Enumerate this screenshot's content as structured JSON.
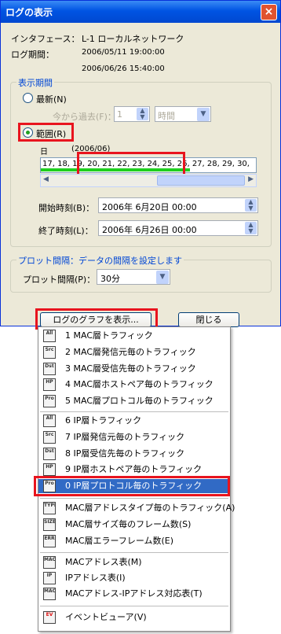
{
  "window": {
    "title": "ログの表示",
    "close": "×"
  },
  "info": {
    "interface_label": "インタフェース：",
    "interface_value": "L-1 ローカルネットワーク",
    "period_label": "ログ期間：",
    "period_start": "2006/05/11 19:00:00",
    "period_end": "2006/06/26 15:40:00"
  },
  "display_period": {
    "group_title": "表示期間",
    "latest_label": "最新(N)",
    "past_label": "今から過去(F)：",
    "past_value": "1",
    "past_unit": "時間",
    "range_label": "範囲(R)",
    "timeline_day_label": "日",
    "timeline_month": "(2006/06)",
    "timeline_days": "17, 18, 19, 20, 21, 22, 23, 24, 25, 26, 27, 28, 29, 30,",
    "start_label": "開始時刻(B)：",
    "start_value": "2006年  6月20日  00:00",
    "end_label": "終了時刻(L)：",
    "end_value": "2006年  6月26日  00:00"
  },
  "plot": {
    "group_title": "プロット間隔：データの間隔を設定します",
    "interval_label": "プロット間隔(P)：",
    "interval_value": "30分"
  },
  "buttons": {
    "show_graph": "ログのグラフを表示...",
    "close": "閉じる"
  },
  "menu": [
    {
      "label": "1 MAC層トラフィック",
      "icon": "All"
    },
    {
      "label": "2 MAC層発信元毎のトラフィック",
      "icon": "Src"
    },
    {
      "label": "3 MAC層受信先毎のトラフィック",
      "icon": "Dst"
    },
    {
      "label": "4 MAC層ホストペア毎のトラフィック",
      "icon": "HP"
    },
    {
      "label": "5 MAC層プロトコル毎のトラフィック",
      "icon": "Pro"
    },
    {
      "label": "6 IP層トラフィック",
      "icon": "All"
    },
    {
      "label": "7 IP層発信元毎のトラフィック",
      "icon": "Src"
    },
    {
      "label": "8 IP層受信先毎のトラフィック",
      "icon": "Dst"
    },
    {
      "label": "9 IP層ホストペア毎のトラフィック",
      "icon": "HP"
    },
    {
      "label": "0 IP層プロトコル毎のトラフィック",
      "icon": "Pro"
    },
    {
      "label": "MAC層アドレスタイプ毎のトラフィック(A)",
      "icon": "TYPE"
    },
    {
      "label": "MAC層サイズ毎のフレーム数(S)",
      "icon": "SIZE"
    },
    {
      "label": "MAC層エラーフレーム数(E)",
      "icon": "ERR"
    },
    {
      "label": "MACアドレス表(M)",
      "icon": "MAC"
    },
    {
      "label": "IPアドレス表(I)",
      "icon": "IP"
    },
    {
      "label": "MACアドレス-IPアドレス対応表(T)",
      "icon": "MACIP"
    },
    {
      "label": "イベントビューア(V)",
      "icon": "EV"
    }
  ]
}
